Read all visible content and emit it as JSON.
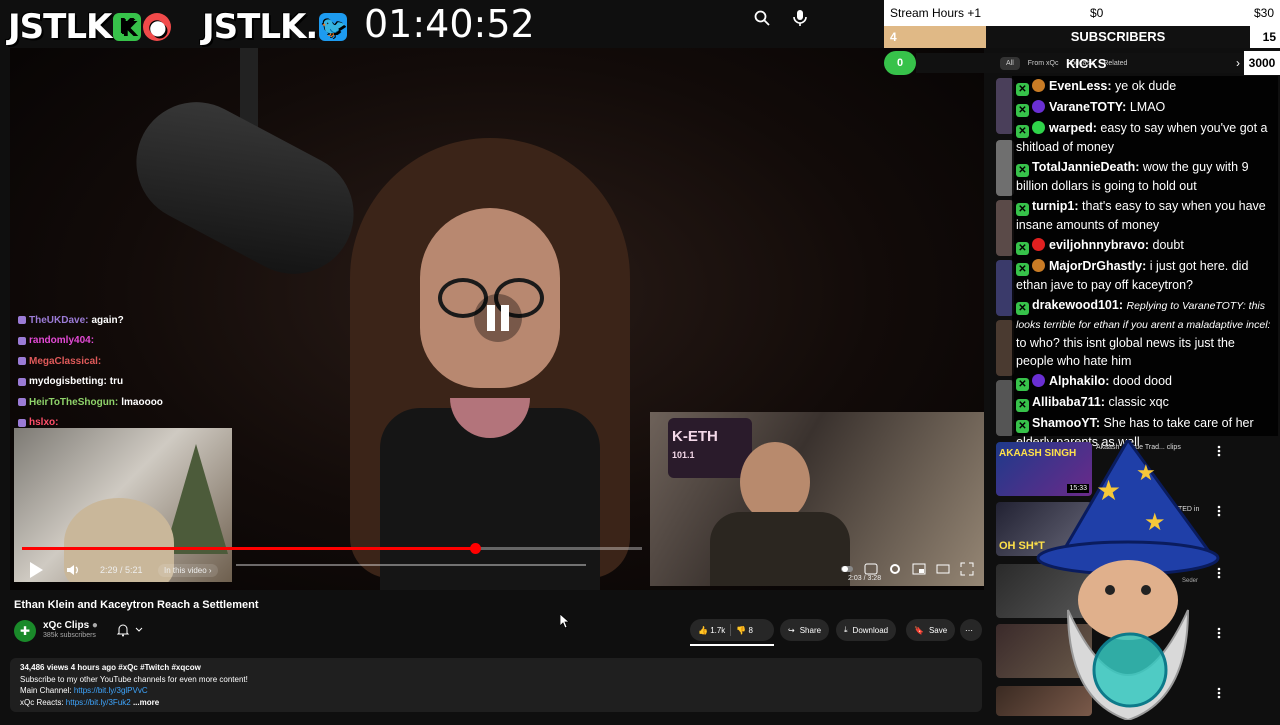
{
  "logos": {
    "left_text": "JSTLK",
    "left_badge": "K",
    "right_text": "JSTLK."
  },
  "timer": "01:40:52",
  "video": {
    "title": "Ethan Klein and Kaceytron Reach a Settlement",
    "time": "2:29 / 5:21",
    "in_video": "In this video ›",
    "progress": 0.73,
    "ethan_cam_time": "2:03 / 3:28",
    "sign_text": "K-ETH",
    "sign_sub": "101.1"
  },
  "channel": {
    "name": "xQc Clips",
    "subs": "385k subscribers"
  },
  "actions": {
    "likes": "1.7k",
    "dislikes": "8",
    "share": "Share",
    "download": "Download",
    "save": "Save"
  },
  "description": {
    "meta": "34,486 views  4 hours ago  #xQc #Twitch #xqcow",
    "line1": "Subscribe to my other YouTube channels for even more content!",
    "main_label": "Main Channel: ",
    "main_link": "https://bit.ly/3glPVvC",
    "reacts_label": "xQc Reacts: ",
    "reacts_link": "https://bit.ly/3Fuk2",
    "more": "...more"
  },
  "left_chat": [
    {
      "user": "TheUKDave:",
      "text": "again?",
      "color": "#9b7bd6"
    },
    {
      "user": "randomly404:",
      "text": "",
      "color": "#e34ad6"
    },
    {
      "user": "MegaClassical:",
      "text": "",
      "color": "#e05a5a"
    },
    {
      "user": "mydogisbetting:",
      "text": "tru",
      "color": "#ffffff"
    },
    {
      "user": "HeirToTheShogun:",
      "text": "lmaoooo",
      "color": "#8fd36a"
    },
    {
      "user": "hslxo:",
      "text": "",
      "color": "#ff4f6a"
    }
  ],
  "hud": {
    "stream_hours": "Stream Hours +1",
    "money_start": "$0",
    "money_end": "$30",
    "subs_count": "4",
    "subs_label": "SUBSCRIBERS",
    "subs_goal": "15",
    "kicks_count": "0",
    "kicks_label": "KICKS",
    "kicks_goal": "3000",
    "filters": [
      "All",
      "From xQc",
      "Podcasts",
      "Related"
    ]
  },
  "right_chat": [
    {
      "user": "EvenLess:",
      "text": "ye ok dude",
      "dot": "#c87b25"
    },
    {
      "user": "VaraneTOTY:",
      "text": "LMAO",
      "dot": "#6a2fd3"
    },
    {
      "user": "warped:",
      "text": "easy to say when you've got a shitload of money",
      "dot": "#2fd34a"
    },
    {
      "user": "TotalJannieDeath:",
      "text": "wow the guy with 9 billion dollars is going to hold out",
      "dot": ""
    },
    {
      "user": "turnip1:",
      "text": "that's easy to say when you have insane amounts of money",
      "dot": ""
    },
    {
      "user": "eviljohnnybravo:",
      "text": "doubt",
      "dot": "#e02020"
    },
    {
      "user": "MajorDrGhastly:",
      "text": "i just got here. did ethan jave to pay off kaceytron?",
      "dot": "#c87b25"
    },
    {
      "user": "drakewood101:",
      "reply": "Replying to VaraneTOTY: this looks terrible for ethan if you arent a maladaptive incel:",
      "text": "to who? this isnt global news its just the people who hate him",
      "dot": ""
    },
    {
      "user": "Alphakilo:",
      "text": "dood dood",
      "dot": "#6a2fd3"
    },
    {
      "user": "Allibaba711:",
      "text": "classic xqc",
      "dot": ""
    },
    {
      "user": "ShamooYT:",
      "text": "She has to take care of her elderly parents as well",
      "dot": ""
    }
  ],
  "sidebar": [
    {
      "title": "Akaash ... True Trad... clips",
      "thumb_text": "AKAASH SINGH",
      "duration": "15:33"
    },
    {
      "title": "...ATED in",
      "thumb_text": "OH SH*T",
      "duration": ""
    },
    {
      "title": "Seder",
      "thumb_text": "",
      "duration": ""
    },
    {
      "title": "",
      "thumb_text": "",
      "duration": ""
    },
    {
      "title": "",
      "thumb_text": "",
      "duration": ""
    }
  ],
  "colors": {
    "accent_red": "#ff0000",
    "kick_green": "#37c24a",
    "bg": "#0f0f0f"
  }
}
